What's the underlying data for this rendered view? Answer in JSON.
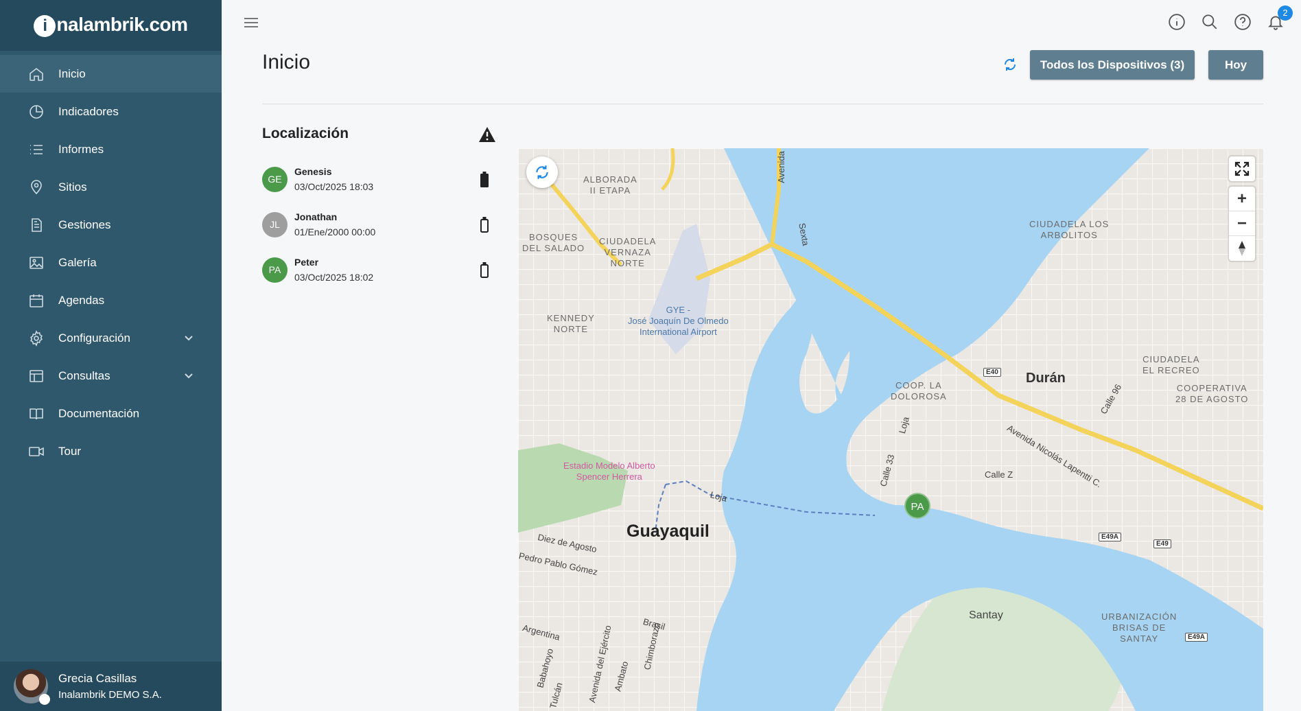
{
  "brand": {
    "name": "inalambrik.com",
    "initial": "i",
    "rest": "nalambrik.com"
  },
  "sidebar": {
    "items": [
      {
        "label": "Inicio",
        "icon": "home-icon",
        "active": true
      },
      {
        "label": "Indicadores",
        "icon": "pie-chart-icon"
      },
      {
        "label": "Informes",
        "icon": "list-icon"
      },
      {
        "label": "Sitios",
        "icon": "location-pin-icon"
      },
      {
        "label": "Gestiones",
        "icon": "document-icon"
      },
      {
        "label": "Galería",
        "icon": "image-icon"
      },
      {
        "label": "Agendas",
        "icon": "calendar-icon"
      },
      {
        "label": "Configuración",
        "icon": "gear-icon",
        "expandable": true
      },
      {
        "label": "Consultas",
        "icon": "table-icon",
        "expandable": true
      },
      {
        "label": "Documentación",
        "icon": "book-icon"
      },
      {
        "label": "Tour",
        "icon": "video-camera-icon"
      }
    ]
  },
  "user": {
    "name": "Grecia Casillas",
    "org": "Inalambrik DEMO S.A."
  },
  "topbar": {
    "notifications": "2"
  },
  "header": {
    "title": "Inicio",
    "devices_button": "Todos los Dispositivos (3)",
    "today_button": "Hoy"
  },
  "locations": {
    "title": "Localización",
    "devices": [
      {
        "initials": "GE",
        "name": "Genesis",
        "time": "03/Oct/2025 18:03",
        "color": "#4a9a4a",
        "battery": "full"
      },
      {
        "initials": "JL",
        "name": "Jonathan",
        "time": "01/Ene/2000 00:00",
        "color": "#9e9e9e",
        "battery": "empty"
      },
      {
        "initials": "PA",
        "name": "Peter",
        "time": "03/Oct/2025 18:02",
        "color": "#4a9a4a",
        "battery": "empty"
      }
    ]
  },
  "map": {
    "marker": "PA",
    "labels": {
      "alborada": "ALBORADA\nII ETAPA",
      "bosques": "BOSQUES\nDEL SALADO",
      "vernaza": "CIUDADELA\nVERNAZA\nNORTE",
      "kennedy": "KENNEDY\nNORTE",
      "arbolitos": "CIUDADELA LOS\nARBOLITOS",
      "recreo": "CIUDADELA\nEL RECREO",
      "cooperativa": "COOPERATIVA\n28 DE AGOSTO",
      "dolorosa": "COOP. LA\nDOLOROSA",
      "urbanizacion": "URBANIZACIÓN\nBRISAS DE\nSANTAY"
    },
    "airport": "GYE -\nJosé Joaquín De Olmedo\nInternational Airport",
    "stadium": "Estadio Modelo Alberto\nSpencer Herrera",
    "city": "Guayaquil",
    "town_duran": "Durán",
    "town_santay": "Santay",
    "streets": {
      "avenida": "Avenida",
      "sexta": "Sexta",
      "loja": "Loja",
      "loja2": "Loja",
      "diez": "Diez de Agosto",
      "pedro": "Pedro Pablo Gómez",
      "brasil": "Brasil",
      "argentina": "Argentina",
      "babahoyo": "Babahoyo",
      "tulcan": "Tulcán",
      "ejercito": "Avenida del Ejército",
      "ambato": "Ambato",
      "chimborazo": "Chimborazo",
      "calle33": "Calle 33",
      "callez": "Calle Z",
      "calle96": "Calle 96",
      "lapenti": "Avenida Nicolás Lapentti C."
    },
    "shields": {
      "e40": "E40",
      "e49a": "E49A",
      "e49": "E49",
      "e49a2": "E49A"
    }
  }
}
